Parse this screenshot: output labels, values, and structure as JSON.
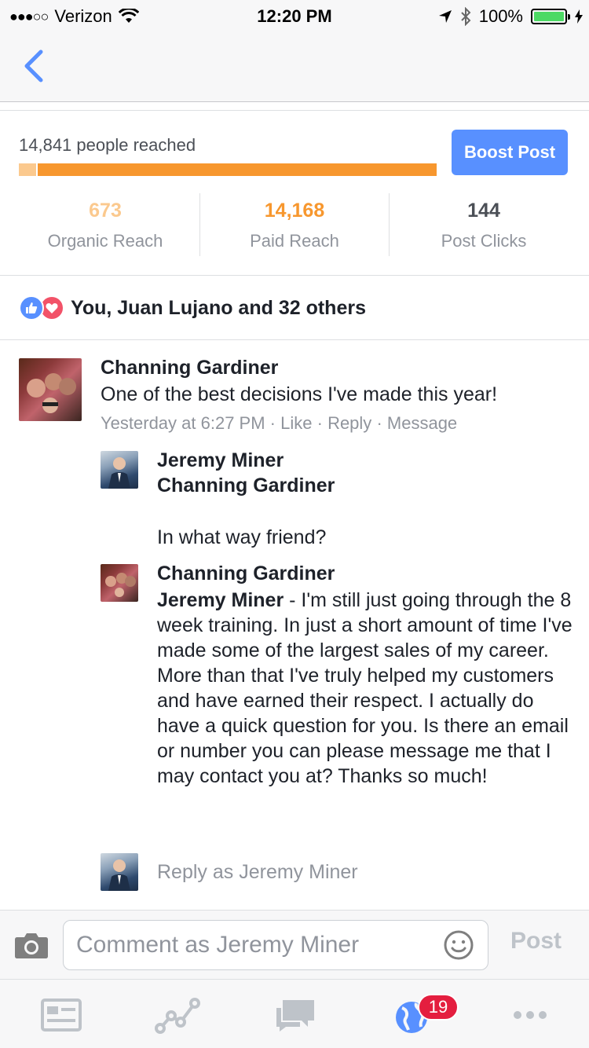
{
  "status_bar": {
    "signal": "●●●○○",
    "carrier": "Verizon",
    "time": "12:20 PM",
    "battery_percent": "100%"
  },
  "insights": {
    "reach_label": "14,841 people reached",
    "organic_share": 0.045,
    "boost_label": "Boost Post",
    "stats": [
      {
        "value": "673",
        "label": "Organic Reach",
        "color": "#fbc98e"
      },
      {
        "value": "14,168",
        "label": "Paid Reach",
        "color": "#f7972e"
      },
      {
        "value": "144",
        "label": "Post Clicks",
        "color": "#4b4f56"
      }
    ]
  },
  "reactions": {
    "text": "You, Juan Lujano and 32 others"
  },
  "comment": {
    "author": "Channing Gardiner",
    "text": "One of the best decisions I've made this year!",
    "time": "Yesterday at 6:27 PM",
    "like": "Like",
    "reply": "Reply",
    "message": "Message"
  },
  "replies": [
    {
      "author": "Jeremy Miner",
      "tag": "Channing Gardiner",
      "text": "In what way friend?"
    },
    {
      "author": "Channing Gardiner",
      "tag": "Jeremy Miner",
      "text": " - I'm still just going through the 8 week training. In just a short amount of time I've made some of the largest sales of my career. More than that I've truly helped my customers and have earned their respect. I actually do have a quick question for you. Is there an email or number you can please message me that I may contact you at? Thanks so much!"
    }
  ],
  "reply_as": "Reply as Jeremy Miner",
  "composer": {
    "placeholder": "Comment as Jeremy Miner",
    "post_label": "Post"
  },
  "tabbar": {
    "notifications_badge": "19",
    "accent": "#5890ff",
    "icon_color": "#bec3c9"
  }
}
